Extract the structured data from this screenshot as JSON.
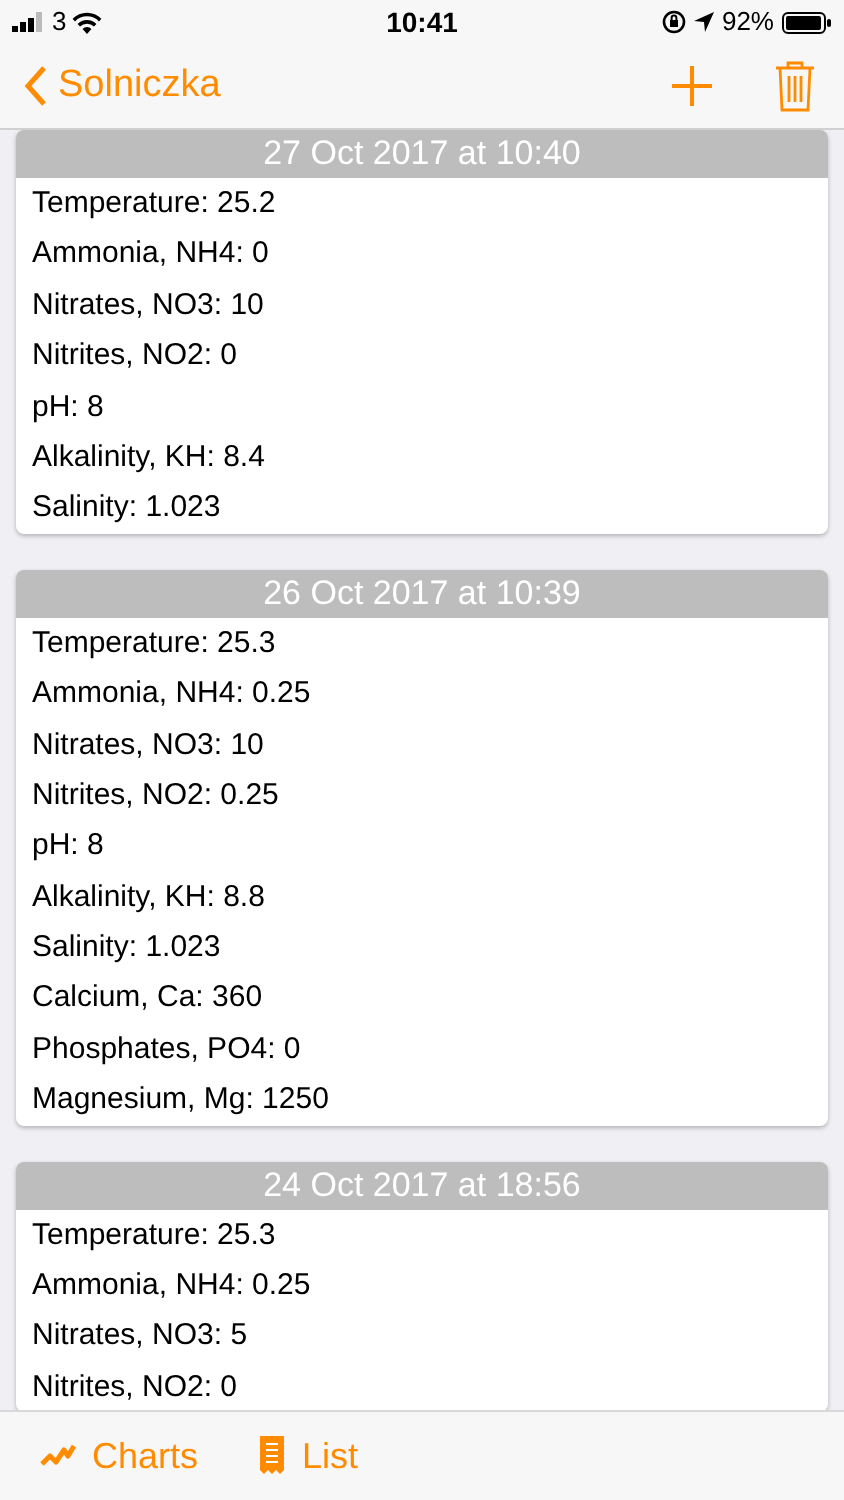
{
  "status_bar": {
    "carrier": "3",
    "time": "10:41",
    "battery": "92%"
  },
  "nav_bar": {
    "back_label": "Solniczka"
  },
  "entries": [
    {
      "date": "27 Oct 2017 at 10:40",
      "readings": [
        "Temperature: 25.2",
        "Ammonia, NH4: 0",
        "Nitrates, NO3: 10",
        "Nitrites, NO2: 0",
        "pH: 8",
        "Alkalinity, KH: 8.4",
        "Salinity: 1.023"
      ]
    },
    {
      "date": "26 Oct 2017 at 10:39",
      "readings": [
        "Temperature: 25.3",
        "Ammonia, NH4: 0.25",
        "Nitrates, NO3: 10",
        "Nitrites, NO2: 0.25",
        "pH: 8",
        "Alkalinity, KH: 8.8",
        "Salinity: 1.023",
        "Calcium, Ca: 360",
        "Phosphates, PO4: 0",
        "Magnesium, Mg: 1250"
      ]
    },
    {
      "date": "24 Oct 2017 at 18:56",
      "readings": [
        "Temperature: 25.3",
        "Ammonia, NH4: 0.25",
        "Nitrates, NO3: 5",
        "Nitrites, NO2: 0"
      ]
    }
  ],
  "tab_bar": [
    {
      "label": "Charts",
      "kind": "charts"
    },
    {
      "label": "List",
      "kind": "list"
    }
  ]
}
